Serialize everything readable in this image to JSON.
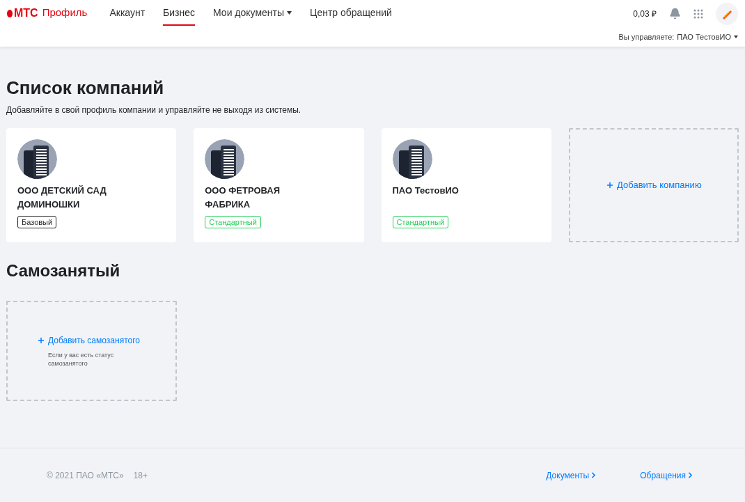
{
  "header": {
    "logo": "МТС",
    "product": "Профиль",
    "nav": [
      {
        "label": "Аккаунт",
        "selected": false,
        "dropdown": false
      },
      {
        "label": "Бизнес",
        "selected": true,
        "dropdown": false
      },
      {
        "label": "Мои документы",
        "selected": false,
        "dropdown": true
      },
      {
        "label": "Центр обращений",
        "selected": false,
        "dropdown": false
      }
    ],
    "balance": "0,03 ₽",
    "managing_label": "Вы управляете:",
    "managing_value": "ПАО ТестовИО"
  },
  "companies": {
    "title": "Список компаний",
    "subtitle": "Добавляйте в свой профиль компании и управляйте не выходя из системы.",
    "items": [
      {
        "name": "ООО ДЕТСКИЙ САД ДОМИНОШКИ",
        "plan": "Базовый",
        "kind": "basic"
      },
      {
        "name": "ООО ФЕТРОВАЯ ФАБРИКА",
        "plan": "Стандартный",
        "kind": "standard"
      },
      {
        "name": "ПАО ТестовИО",
        "plan": "Стандартный",
        "kind": "standard"
      }
    ],
    "add_label": "Добавить компанию"
  },
  "self_employed": {
    "title": "Самозанятый",
    "add_label": "Добавить самозанятого",
    "hint": "Если у вас есть статус самозанятого"
  },
  "footer": {
    "copyright": "© 2021 ПАО «МТС»",
    "age": "18+",
    "links": [
      "Документы",
      "Обращения"
    ]
  }
}
